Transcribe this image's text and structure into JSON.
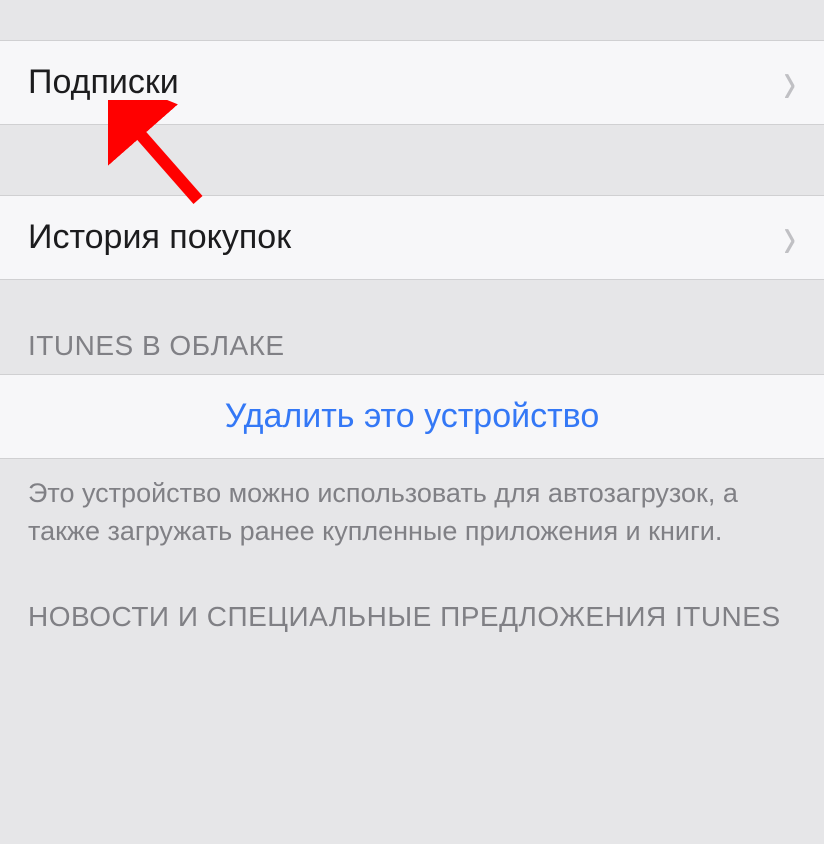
{
  "rows": {
    "subscriptions_label": "Подписки",
    "purchase_history_label": "История покупок"
  },
  "sections": {
    "itunes_cloud_header": "iTunes в облаке",
    "remove_device_label": "Удалить это устройство",
    "remove_device_footer": "Это устройство можно использовать для автозагрузок, а также загружать ранее купленные приложения и книги.",
    "news_offers_header": "Новости и специальные предложения iTunes"
  },
  "annotation": {
    "arrow_color": "#ff0000"
  }
}
